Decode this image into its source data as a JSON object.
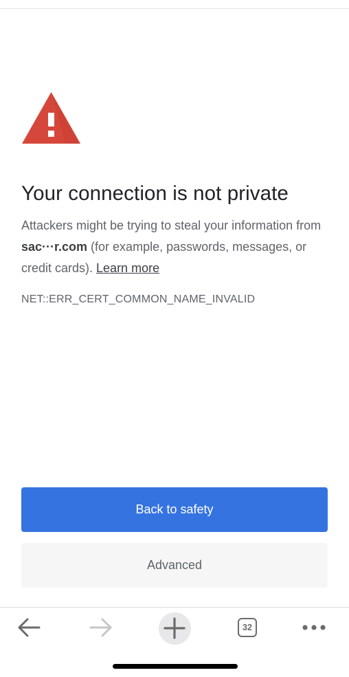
{
  "page": {
    "headline": "Your connection is not private",
    "body_prefix": "Attackers might be trying to steal your information from ",
    "domain": "sac···r.com",
    "body_middle": " (for example, passwords, messages, or credit cards). ",
    "learn_more": "Learn more",
    "error_code": "NET::ERR_CERT_COMMON_NAME_INVALID"
  },
  "buttons": {
    "back_to_safety": "Back to safety",
    "advanced": "Advanced"
  },
  "toolbar": {
    "tab_count": "32",
    "icons": [
      "back-arrow-icon",
      "forward-arrow-icon",
      "plus-icon",
      "tab-switcher-icon",
      "more-menu-icon"
    ]
  },
  "colors": {
    "warning_red": "#d6473b",
    "primary_blue": "#3573e0",
    "secondary_bg": "#f6f6f6",
    "heading_text": "#202124",
    "body_text": "#5f6368"
  }
}
